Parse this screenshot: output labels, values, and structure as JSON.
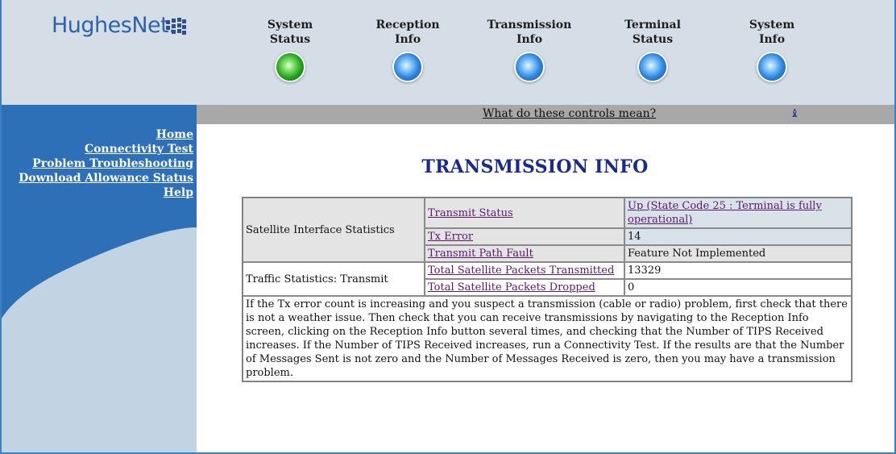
{
  "brand": {
    "logo_text": "HughesNet."
  },
  "nav": [
    {
      "label": "System\nStatus",
      "state": "green"
    },
    {
      "label": "Reception\nInfo",
      "state": "blue"
    },
    {
      "label": "Transmission\nInfo",
      "state": "blue"
    },
    {
      "label": "Terminal\nStatus",
      "state": "blue"
    },
    {
      "label": "System\nInfo",
      "state": "blue"
    }
  ],
  "help_bar": {
    "link_text": "What do these controls mean?"
  },
  "sidebar": {
    "items": [
      {
        "label": "Home"
      },
      {
        "label": "Connectivity Test"
      },
      {
        "label": "Problem Troubleshooting"
      },
      {
        "label": "Download Allowance Status"
      },
      {
        "label": "Help"
      }
    ]
  },
  "main": {
    "title": "TRANSMISSION INFO",
    "groups": [
      {
        "name": "Satellite Interface Statistics",
        "rows": [
          {
            "label": "Transmit Status",
            "value": "Up (State Code 25 : Terminal is fully operational)",
            "value_is_link": true
          },
          {
            "label": "Tx Error",
            "value": "14",
            "value_is_link": false
          },
          {
            "label": "Transmit Path Fault",
            "value": "Feature Not Implemented",
            "value_is_link": false
          }
        ]
      },
      {
        "name": "Traffic Statistics: Transmit",
        "rows": [
          {
            "label": "Total Satellite Packets Transmitted",
            "value": "13329",
            "value_is_link": false
          },
          {
            "label": "Total Satellite Packets Dropped",
            "value": "0",
            "value_is_link": false
          }
        ]
      }
    ],
    "note": "If the Tx error count is increasing and you suspect a transmission (cable or radio) problem, first check that there is not a weather issue. Then check that you can receive transmissions by navigating to the Reception Info screen, clicking on the Reception Info button several times, and checking that the Number of TIPS Received increases. If the Number of TIPS Received increases, run a Connectivity Test. If the results are that the Number of Messages Sent is not zero and the Number of Messages Received is zero, then you may have a transmission problem."
  },
  "colors": {
    "sidebar_blue": "#2d70b8",
    "header_gray": "#d5dee6",
    "title_navy": "#1a2a8c",
    "link_purple": "#5a1a6e"
  }
}
